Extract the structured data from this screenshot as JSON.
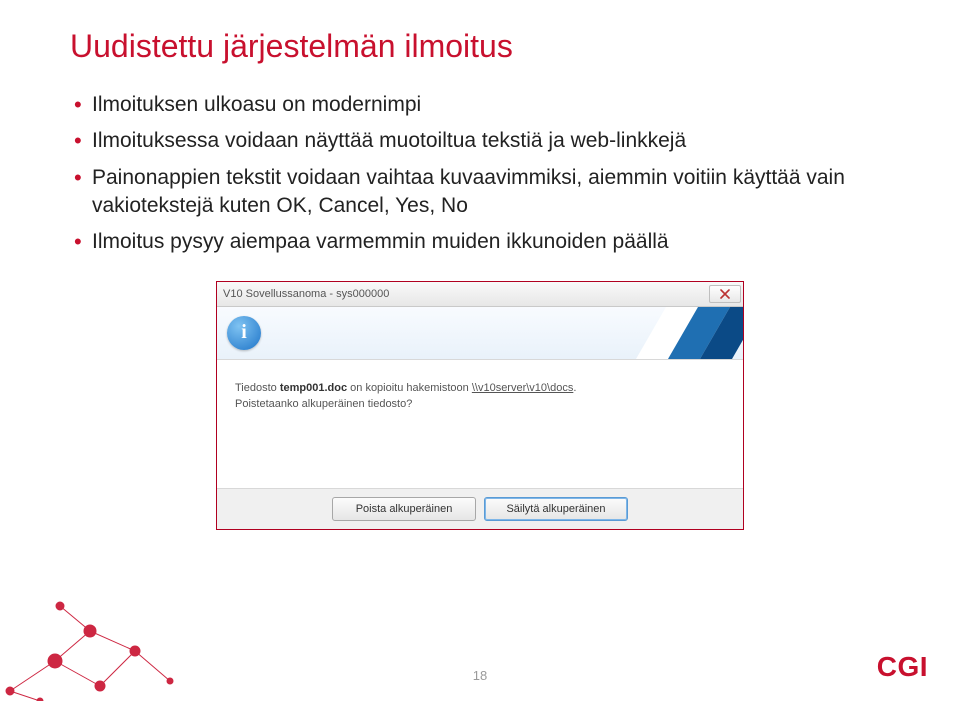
{
  "title": "Uudistettu järjestelmän ilmoitus",
  "bullets": [
    "Ilmoituksen ulkoasu on modernimpi",
    "Ilmoituksessa voidaan näyttää muotoiltua tekstiä ja web-linkkejä",
    "Painonappien tekstit voidaan vaihtaa kuvaavimmiksi, aiemmin voitiin käyttää vain vakiotekstejä kuten OK, Cancel, Yes, No",
    "Ilmoitus pysyy aiempaa varmemmin muiden ikkunoiden päällä"
  ],
  "dialog": {
    "title": "V10 Sovellussanoma - sys000000",
    "info_icon_label": "i",
    "message_prefix": "Tiedosto ",
    "message_bold": "temp001.doc",
    "message_middle": " on kopioitu hakemistoon ",
    "message_link": "\\\\v10server\\v10\\docs",
    "message_suffix": ".",
    "message_line2": "Poistetaanko alkuperäinen tiedosto?",
    "buttons": {
      "primary": "Poista alkuperäinen",
      "secondary": "Säilytä alkuperäinen"
    }
  },
  "page_number": "18",
  "logo_text": "CGI"
}
